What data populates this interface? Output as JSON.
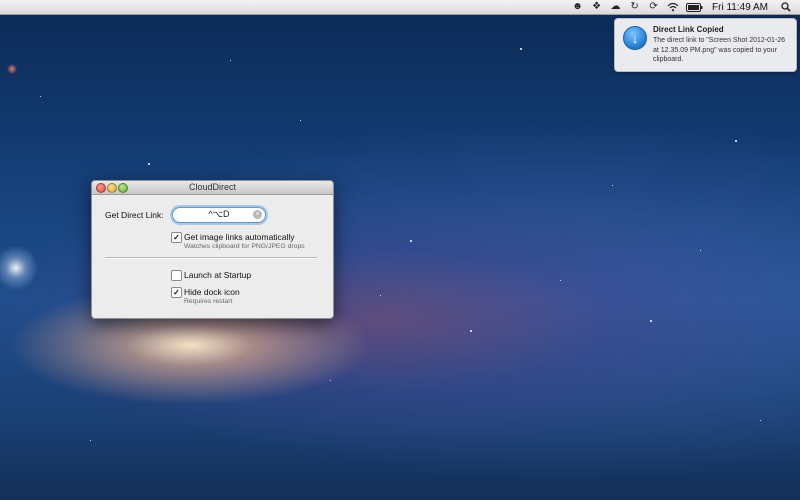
{
  "menubar": {
    "icons": [
      "cat-icon",
      "dropbox-icon",
      "cloud-icon",
      "sync-icon",
      "refresh-icon",
      "wifi-icon",
      "battery-icon"
    ],
    "clock": "Fri 11:49 AM",
    "search_icon": "spotlight-icon"
  },
  "notification": {
    "title": "Direct Link Copied",
    "message": "The direct link to \"Screen Shot 2012-01-26 at 12.35.09 PM.png\" was copied to your clipboard.",
    "icon": "download-arrow-icon"
  },
  "window": {
    "title": "CloudDirect",
    "get_link_label": "Get Direct Link:",
    "shortcut_value": "^⌥D",
    "options": [
      {
        "label": "Get image links automatically",
        "sub": "Watches clipboard for PNG/JPEG drops",
        "checked": true
      },
      {
        "label": "Launch at Startup",
        "sub": "",
        "checked": false
      },
      {
        "label": "Hide dock icon",
        "sub": "Requires restart",
        "checked": true
      }
    ]
  }
}
